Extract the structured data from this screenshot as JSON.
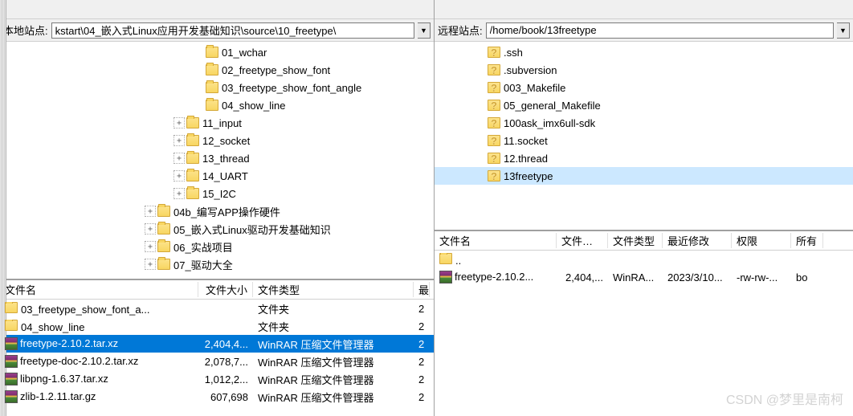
{
  "left": {
    "path_label": "本地站点:",
    "path_value": "kstart\\04_嵌入式Linux应用开发基础知识\\source\\10_freetype\\",
    "tree": [
      {
        "indent": 240,
        "expander": "",
        "icon": "folder",
        "label": "01_wchar"
      },
      {
        "indent": 240,
        "expander": "",
        "icon": "folder",
        "label": "02_freetype_show_font"
      },
      {
        "indent": 240,
        "expander": "",
        "icon": "folder",
        "label": "03_freetype_show_font_angle"
      },
      {
        "indent": 240,
        "expander": "",
        "icon": "folder",
        "label": "04_show_line"
      },
      {
        "indent": 216,
        "expander": "+",
        "icon": "folder",
        "label": "11_input"
      },
      {
        "indent": 216,
        "expander": "+",
        "icon": "folder",
        "label": "12_socket"
      },
      {
        "indent": 216,
        "expander": "+",
        "icon": "folder",
        "label": "13_thread"
      },
      {
        "indent": 216,
        "expander": "+",
        "icon": "folder",
        "label": "14_UART"
      },
      {
        "indent": 216,
        "expander": "+",
        "icon": "folder",
        "label": "15_I2C"
      },
      {
        "indent": 180,
        "expander": "+",
        "icon": "folder",
        "label": "04b_编写APP操作硬件"
      },
      {
        "indent": 180,
        "expander": "+",
        "icon": "folder",
        "label": "05_嵌入式Linux驱动开发基础知识"
      },
      {
        "indent": 180,
        "expander": "+",
        "icon": "folder",
        "label": "06_实战项目"
      },
      {
        "indent": 180,
        "expander": "+",
        "icon": "folder",
        "label": "07_驱动大全"
      }
    ],
    "grid": {
      "headers": {
        "name": "文件名",
        "size": "文件大小",
        "type": "文件类型",
        "mod": "最"
      },
      "rows": [
        {
          "icon": "folder",
          "name": "03_freetype_show_font_a...",
          "size": "",
          "type": "文件夹",
          "mod": "2",
          "selected": false
        },
        {
          "icon": "folder",
          "name": "04_show_line",
          "size": "",
          "type": "文件夹",
          "mod": "2",
          "selected": false
        },
        {
          "icon": "rar",
          "name": "freetype-2.10.2.tar.xz",
          "size": "2,404,4...",
          "type": "WinRAR 压缩文件管理器",
          "mod": "2",
          "selected": true
        },
        {
          "icon": "rar",
          "name": "freetype-doc-2.10.2.tar.xz",
          "size": "2,078,7...",
          "type": "WinRAR 压缩文件管理器",
          "mod": "2",
          "selected": false
        },
        {
          "icon": "rar",
          "name": "libpng-1.6.37.tar.xz",
          "size": "1,012,2...",
          "type": "WinRAR 压缩文件管理器",
          "mod": "2",
          "selected": false
        },
        {
          "icon": "rar",
          "name": "zlib-1.2.11.tar.gz",
          "size": "607,698",
          "type": "WinRAR 压缩文件管理器",
          "mod": "2",
          "selected": false
        }
      ]
    }
  },
  "right": {
    "path_label": "远程站点:",
    "path_value": "/home/book/13freetype",
    "tree": [
      {
        "icon": "q",
        "label": ".ssh"
      },
      {
        "icon": "q",
        "label": ".subversion"
      },
      {
        "icon": "q",
        "label": "003_Makefile"
      },
      {
        "icon": "q",
        "label": "05_general_Makefile"
      },
      {
        "icon": "q",
        "label": "100ask_imx6ull-sdk"
      },
      {
        "icon": "q",
        "label": "11.socket"
      },
      {
        "icon": "q",
        "label": "12.thread"
      },
      {
        "icon": "q",
        "label": "13freetype",
        "selected": true
      }
    ],
    "grid": {
      "headers": {
        "name": "文件名",
        "size": "文件大小",
        "type": "文件类型",
        "mod": "最近修改",
        "perm": "权限",
        "own": "所有"
      },
      "rows": [
        {
          "icon": "folder",
          "name": "..",
          "size": "",
          "type": "",
          "mod": "",
          "perm": "",
          "own": ""
        },
        {
          "icon": "rar",
          "name": "freetype-2.10.2...",
          "size": "2,404,...",
          "type": "WinRA...",
          "mod": "2023/3/10...",
          "perm": "-rw-rw-...",
          "own": "bo"
        }
      ]
    }
  },
  "watermark": "CSDN @梦里是南柯"
}
